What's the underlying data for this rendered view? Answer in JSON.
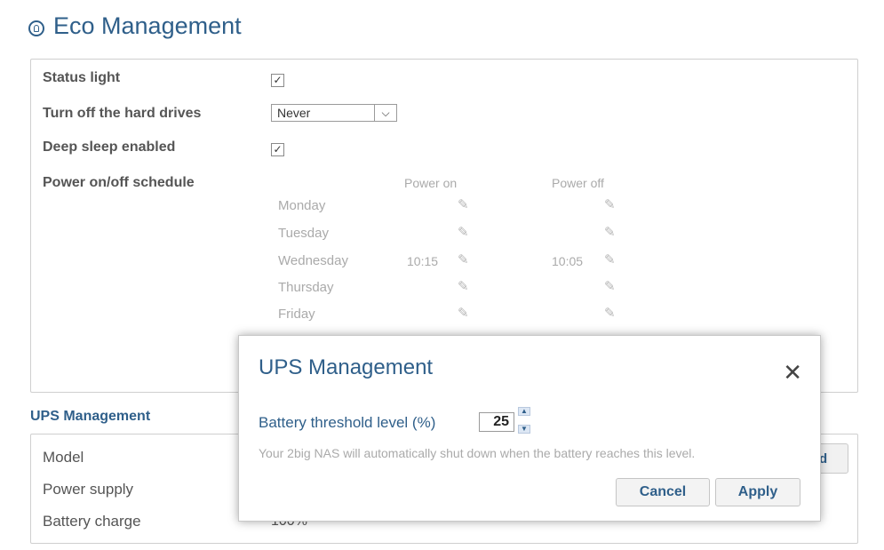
{
  "header": {
    "title": "Eco Management",
    "icon": "lightbulb-icon"
  },
  "eco": {
    "status_light": {
      "label": "Status light",
      "checked": true
    },
    "hard_drives": {
      "label": "Turn off the hard drives",
      "value": "Never"
    },
    "deep_sleep": {
      "label": "Deep sleep enabled",
      "checked": true
    },
    "schedule": {
      "label": "Power on/off schedule",
      "col_on": "Power on",
      "col_off": "Power off",
      "days": [
        {
          "name": "Monday",
          "on": "",
          "off": ""
        },
        {
          "name": "Tuesday",
          "on": "",
          "off": ""
        },
        {
          "name": "Wednesday",
          "on": "10:15",
          "off": "10:05"
        },
        {
          "name": "Thursday",
          "on": "",
          "off": ""
        },
        {
          "name": "Friday",
          "on": "",
          "off": ""
        }
      ]
    }
  },
  "ups": {
    "heading": "UPS Management",
    "model_label": "Model",
    "power_supply_label": "Power supply",
    "battery_charge_label": "Battery charge",
    "battery_charge_value": "100%"
  },
  "modal": {
    "title": "UPS Management",
    "threshold_label": "Battery threshold level (%)",
    "threshold_value": "25",
    "note": "Your 2big NAS will automatically shut down when the battery reaches this level.",
    "cancel_label": "Cancel",
    "apply_label": "Apply"
  },
  "colors": {
    "accent": "#2f5f8a",
    "muted_text": "#aaaaaa"
  }
}
